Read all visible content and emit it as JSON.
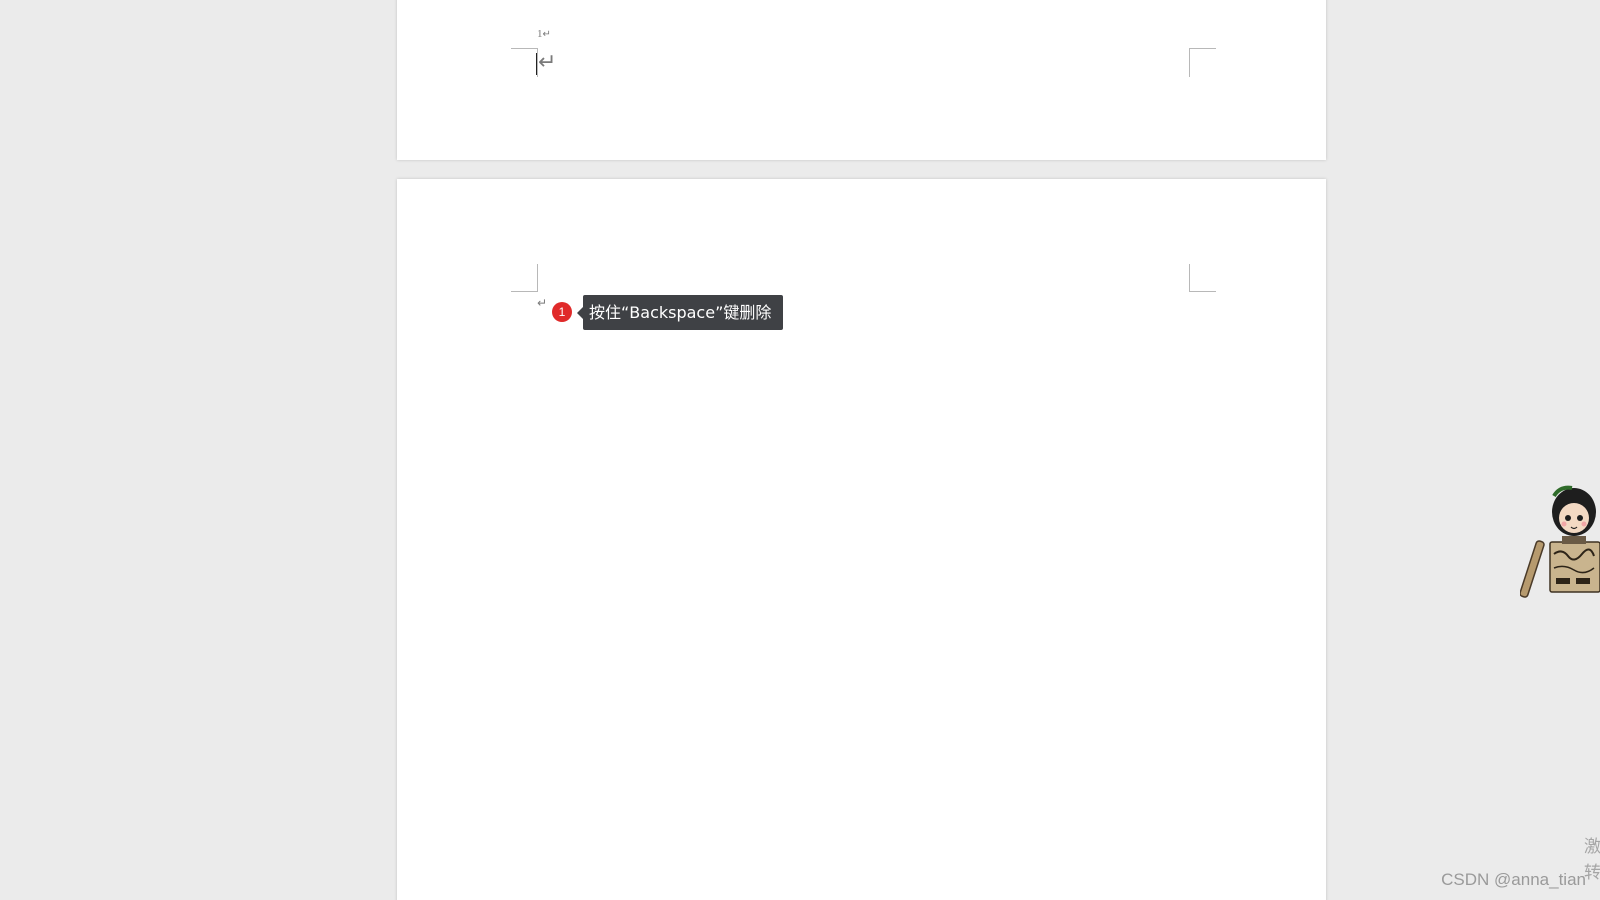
{
  "document": {
    "page1": {
      "page_number": "1",
      "page_number_mark": "↵",
      "paragraph_mark": "↵"
    },
    "page2": {
      "paragraph_mark": "↵"
    }
  },
  "hint": {
    "step": "1",
    "text": "按住“Backspace”键删除"
  },
  "watermark": {
    "text": "CSDN @anna_tian",
    "side_chars": [
      "激",
      "转"
    ]
  },
  "colors": {
    "badge": "#e02a2a",
    "tooltip_bg": "#3f4145",
    "page": "#ffffff",
    "background": "#ebebeb"
  },
  "icons": {
    "mascot": "mascot-sticker-icon",
    "paragraph": "paragraph-mark-icon"
  }
}
